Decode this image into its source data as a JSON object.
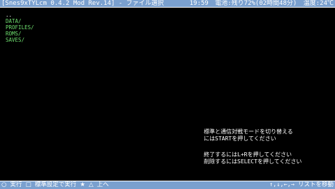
{
  "header": {
    "title": "[Snes9xTYLcm 0.4.2 Mod Rev.14] - ファイル選択",
    "time": "19:59",
    "battery": "電池:残り72%(02時間48分)",
    "temperature": "温度:24℃"
  },
  "files": [
    {
      "name": "..",
      "type": "parent"
    },
    {
      "name": "DATA/",
      "type": "folder"
    },
    {
      "name": "PROFILES/",
      "type": "folder"
    },
    {
      "name": "ROMS/",
      "type": "folder"
    },
    {
      "name": "SAVES/",
      "type": "folder"
    }
  ],
  "help": {
    "line1": "標準と通信対戦モードを切り替える",
    "line2": "にはSTARTを押してください",
    "line3": "終了するにはL+Rを押してください",
    "line4": "削除するにはSELECTを押してください"
  },
  "footer": {
    "circle_icon": "circle-icon",
    "circle_label": "実行",
    "square_icon": "square-icon",
    "square_label": "標準設定で実行",
    "star_icon": "star-icon",
    "triangle_icon": "triangle-icon",
    "triangle_label": "上へ",
    "dpad_label": "↑,↓,←,→ リストを移動"
  },
  "colors": {
    "bar": "#7aa0cf",
    "folder": "#6fe06f",
    "background": "#000000"
  }
}
